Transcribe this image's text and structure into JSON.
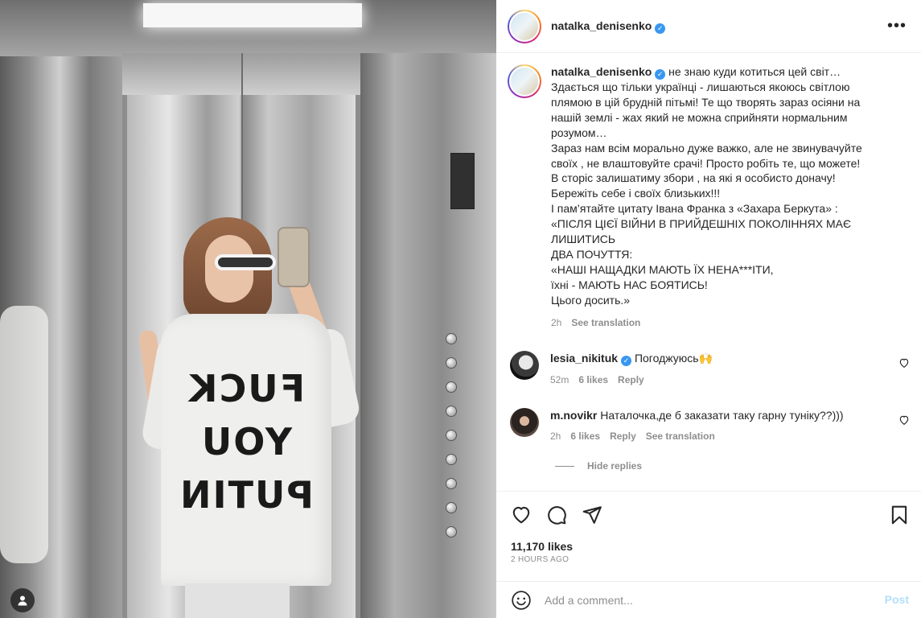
{
  "post": {
    "username": "natalka_denisenko",
    "more_label": "•••"
  },
  "caption": {
    "username": "natalka_denisenko",
    "lines": [
      "не знаю куди котиться цей світ…",
      "Здається що тільки українці - лишаються якоюсь світлою",
      "плямою в цій брудній пітьмі! Те що творять зараз осіяни на",
      "нашій землі - жах який не можна сприйняти нормальним",
      "розумом…",
      "Зараз нам всім морально дуже важко, але не звинувачуйте",
      "своїх , не влаштовуйте срачі! Просто робіть те, що можете!",
      "В сторіс залишатиму збори , на які я особисто доначу!",
      "Бережіть себе і своїх близьких!!!",
      "І пам’ятайте цитату Івана Франка з «Захара Беркута» :",
      "«ПІСЛЯ ЦІЄЇ ВІЙНИ В ПРИЙДЕШНІХ ПОКОЛІННЯХ МАЄ",
      "ЛИШИТИСЬ",
      "ДВА ПОЧУТТЯ:",
      "«НАШІ НАЩАДКИ МАЮТЬ ЇХ НЕНА***ІТИ,",
      "їхні - МАЮТЬ НАС БОЯТИСЬ!",
      "Цього досить.»"
    ],
    "time": "2h",
    "see_translation": "See translation"
  },
  "comments": [
    {
      "username": "lesia_nikituk",
      "verified": true,
      "text": "Погоджуюсь🙌",
      "time": "52m",
      "likes": "6 likes",
      "reply": "Reply"
    },
    {
      "username": "m.novikr",
      "verified": false,
      "text": "Наталочка,де б заказати таку гарну туніку??)))",
      "time": "2h",
      "likes": "6 likes",
      "reply": "Reply",
      "see_translation": "See translation"
    }
  ],
  "hide_replies": "Hide replies",
  "stats": {
    "likes": "11,170 likes",
    "time_ago": "2 HOURS AGO"
  },
  "add_comment": {
    "placeholder": "Add a comment...",
    "post_label": "Post"
  },
  "photo": {
    "shirt_lines": [
      "FUCK",
      "YOU",
      "PUTIN"
    ]
  },
  "colors": {
    "link_blue": "#b2dffc",
    "verified_blue": "#3897f0",
    "muted": "#8e8e8e"
  },
  "icons": [
    "user-tag-icon",
    "heart-icon",
    "comment-icon",
    "share-icon",
    "bookmark-icon",
    "emoji-icon",
    "verified-badge-icon",
    "more-options-icon"
  ]
}
